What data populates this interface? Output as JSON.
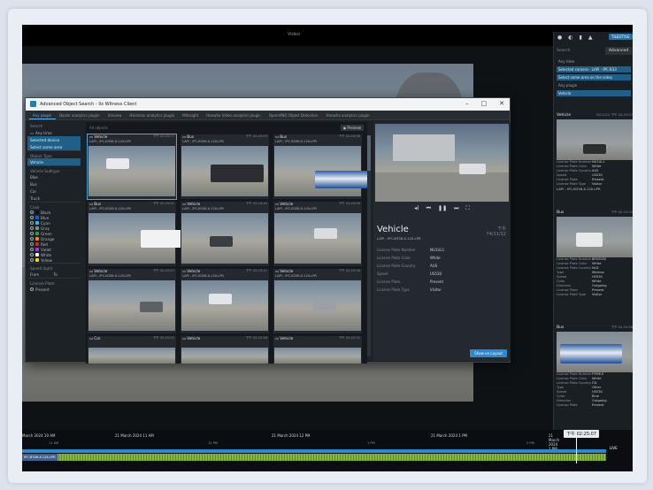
{
  "app": {
    "top_title": "Video",
    "dialog_title": "Advanced Object Search - Ilx Witness Client"
  },
  "plugins": [
    "Any plugin",
    "Basler analytics plugin",
    "Uniview",
    "Hikvision analytics plugin",
    "Milesight",
    "Hanwha Video analytics plugin",
    "OpenVINO Object Detection",
    "Hanwha analytics plugin"
  ],
  "left_filters": {
    "search_placeholder": "Search",
    "time": "Any time",
    "camera": "Selected device",
    "area": "Select some area",
    "object_type_header": "Object Type",
    "object_types": [
      "Vehicle"
    ],
    "vehicle_subtype_header": "Vehicle Subtype",
    "vehicle_subtypes": [
      "Bike",
      "Bus",
      "Car",
      "Truck"
    ],
    "color_header": "Color",
    "colors": [
      {
        "name": "Black",
        "hex": "#111111"
      },
      {
        "name": "Blue",
        "hex": "#2556d8"
      },
      {
        "name": "Cyan",
        "hex": "#1fc7d8"
      },
      {
        "name": "Gray",
        "hex": "#8a8a8a"
      },
      {
        "name": "Green",
        "hex": "#28a43c"
      },
      {
        "name": "Orange",
        "hex": "#f08a1c"
      },
      {
        "name": "Red",
        "hex": "#d82424"
      },
      {
        "name": "Violet",
        "hex": "#9b3fd6"
      },
      {
        "name": "White",
        "hex": "#f2f2f2"
      },
      {
        "name": "Yellow",
        "hex": "#f0d81c"
      }
    ],
    "speed_header": "Speed (kph)",
    "speed_from": "From",
    "speed_to": "To",
    "license_header": "License Plate",
    "license_options": [
      "Present"
    ]
  },
  "grid": {
    "all_label": "All objects",
    "preview_label": "Preview",
    "tiles": [
      {
        "type": "Vehicle",
        "time": "下午 02:25:07",
        "camera": "LAPI - IPC-B336-X-12II-LPR"
      },
      {
        "type": "Bus",
        "time": "下午 02:25:03",
        "camera": "LAPI - IPC-B336-X-12II-LPR"
      },
      {
        "type": "Bus",
        "time": "下午 02:24:58",
        "camera": "LAPI - IPC-B336-X-12II-LPR"
      },
      {
        "type": "Bus",
        "time": "下午 02:24:51",
        "camera": "LAPI - IPC-B336-X-12II-LPR"
      },
      {
        "type": "Vehicle",
        "time": "下午 02:24:44",
        "camera": "LAPI - IPC-B336-X-12II-LPR"
      },
      {
        "type": "Vehicle",
        "time": "下午 02:24:40",
        "camera": "LAPI - IPC-B336-X-12II-LPR"
      },
      {
        "type": "Vehicle",
        "time": "下午 02:23:57",
        "camera": "LAPI - IPC-B336-X-12II-LPR"
      },
      {
        "type": "Vehicle",
        "time": "下午 02:23:41",
        "camera": "LAPI - IPC-B336-X-12II-LPR"
      },
      {
        "type": "Vehicle",
        "time": "下午 02:23:30",
        "camera": "LAPI - IPC-B336-X-12II-LPR"
      },
      {
        "type": "Car",
        "time": "下午 02:23:02",
        "camera": ""
      },
      {
        "type": "Vehicle",
        "time": "下午 02:22:48",
        "camera": ""
      },
      {
        "type": "Vehicle",
        "time": "下午 02:22:31",
        "camera": ""
      }
    ]
  },
  "preview": {
    "type": "Vehicle",
    "time_line1": "下午",
    "time_line2": "74/11/12",
    "camera": "LAPI - IPC-B336-X-12II-LPR",
    "attributes": [
      {
        "k": "License Plate Number",
        "v": "NU1UL1"
      },
      {
        "k": "License Plate Color",
        "v": "White"
      },
      {
        "k": "License Plate Country",
        "v": "AUS"
      },
      {
        "k": "Speed",
        "v": "US530"
      },
      {
        "k": "License Plate",
        "v": "Present"
      },
      {
        "k": "License Plate Type",
        "v": "Visitor"
      }
    ],
    "show_button": "Show on Layout"
  },
  "right_panel": {
    "tab": "TILESTYLE",
    "search": "Search",
    "advanced": "Advanced",
    "filters": [
      "Any time",
      "Selected camera - LAPI - IPC-B33",
      "Select some area on the video",
      "Any plugin",
      "Vehicle"
    ],
    "cards": [
      {
        "type": "Vehicle",
        "time": "76/11/12 下午 02:25:07",
        "camera": "LAPI - IPC-B336-X-12II-LPR",
        "attrs": [
          [
            "License Plate Number",
            "NU1UL1"
          ],
          [
            "License Plate Color",
            "White"
          ],
          [
            "License Plate Country",
            "AUS"
          ],
          [
            "Speed",
            "US530"
          ],
          [
            "License Plate",
            "Present"
          ],
          [
            "License Plate Type",
            "Visitor"
          ]
        ]
      },
      {
        "type": "Bus",
        "time": "下午 02:25:03",
        "camera": "LAPI - IPC-B336-X-12II-LPR",
        "attrs": [
          [
            "License Plate Number",
            "8RSSSSS"
          ],
          [
            "License Plate Color",
            "White"
          ],
          [
            "License Plate Country",
            "NLD"
          ],
          [
            "Type",
            "Minibus"
          ],
          [
            "Speed",
            "US530"
          ],
          [
            "Color",
            "White"
          ],
          [
            "Direction",
            "Outgoing"
          ],
          [
            "License Plate",
            "Present"
          ],
          [
            "License Plate Type",
            "Visitor"
          ]
        ]
      },
      {
        "type": "Bus",
        "time": "下午 02:24:58",
        "camera": "",
        "attrs": [
          [
            "License Plate Number",
            "FY9HUI"
          ],
          [
            "License Plate Color",
            "White"
          ],
          [
            "License Plate Country",
            "ITA"
          ],
          [
            "Type",
            "Other"
          ],
          [
            "Speed",
            "US530"
          ],
          [
            "Color",
            "Blue"
          ],
          [
            "Direction",
            "Outgoing"
          ],
          [
            "License Plate",
            "Present"
          ]
        ]
      }
    ]
  },
  "timeline": {
    "dates": [
      "March 2024 10 AM",
      "21 March 2024 11 AM",
      "21 March 2024 12 PM",
      "21 March 2024 1 PM",
      "21 March 2024 2 PM"
    ],
    "times": [
      "11 AM",
      "12 PM",
      "1 PM",
      "2 PM"
    ],
    "clock": "下午 02:25:07",
    "camera_label": "IPC-B336-X-12II-LPR",
    "live": "LIVE"
  }
}
